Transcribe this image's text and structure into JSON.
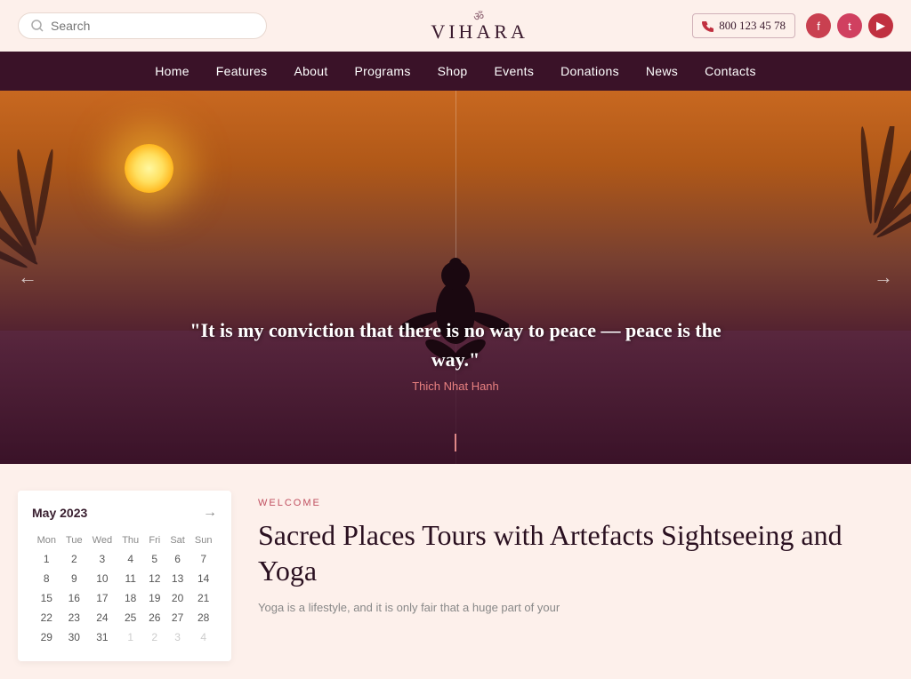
{
  "header": {
    "logo_name": "VIHARA",
    "logo_symbol": "ॐ",
    "search_placeholder": "Search",
    "phone": "800 123 45 78",
    "social": [
      {
        "name": "facebook",
        "label": "f"
      },
      {
        "name": "twitter",
        "label": "t"
      },
      {
        "name": "youtube",
        "label": "▶"
      }
    ]
  },
  "nav": {
    "items": [
      {
        "label": "Home",
        "id": "home"
      },
      {
        "label": "Features",
        "id": "features"
      },
      {
        "label": "About",
        "id": "about"
      },
      {
        "label": "Programs",
        "id": "programs"
      },
      {
        "label": "Shop",
        "id": "shop"
      },
      {
        "label": "Events",
        "id": "events"
      },
      {
        "label": "Donations",
        "id": "donations"
      },
      {
        "label": "News",
        "id": "news"
      },
      {
        "label": "Contacts",
        "id": "contacts"
      }
    ]
  },
  "hero": {
    "quote": "\"It is my conviction that there is no way to peace — peace is the way.\"",
    "author": "Thich Nhat Hanh",
    "arrow_left": "←",
    "arrow_right": "→"
  },
  "calendar": {
    "month_label": "May 2023",
    "nav_next": "→",
    "days_of_week": [
      "Mon",
      "Tue",
      "Wed",
      "Thu",
      "Fri",
      "Sat",
      "Sun"
    ],
    "weeks": [
      [
        {
          "day": "1",
          "other": false
        },
        {
          "day": "2",
          "other": false
        },
        {
          "day": "3",
          "other": false
        },
        {
          "day": "4",
          "other": false
        },
        {
          "day": "5",
          "other": false
        },
        {
          "day": "6",
          "other": false
        },
        {
          "day": "7",
          "other": false
        }
      ],
      [
        {
          "day": "8",
          "other": false
        },
        {
          "day": "9",
          "other": false
        },
        {
          "day": "10",
          "other": false
        },
        {
          "day": "11",
          "other": false
        },
        {
          "day": "12",
          "other": false
        },
        {
          "day": "13",
          "other": false
        },
        {
          "day": "14",
          "other": false
        }
      ],
      [
        {
          "day": "15",
          "other": false
        },
        {
          "day": "16",
          "other": false
        },
        {
          "day": "17",
          "other": false
        },
        {
          "day": "18",
          "other": false
        },
        {
          "day": "19",
          "other": false
        },
        {
          "day": "20",
          "other": false
        },
        {
          "day": "21",
          "other": false
        }
      ],
      [
        {
          "day": "22",
          "other": false
        },
        {
          "day": "23",
          "other": false
        },
        {
          "day": "24",
          "other": false
        },
        {
          "day": "25",
          "other": false
        },
        {
          "day": "26",
          "other": false
        },
        {
          "day": "27",
          "other": false
        },
        {
          "day": "28",
          "other": false
        }
      ],
      [
        {
          "day": "29",
          "other": false
        },
        {
          "day": "30",
          "other": false
        },
        {
          "day": "31",
          "other": false
        },
        {
          "day": "1",
          "other": true
        },
        {
          "day": "2",
          "other": true
        },
        {
          "day": "3",
          "other": true
        },
        {
          "day": "4",
          "other": true
        }
      ]
    ]
  },
  "welcome": {
    "label": "WELCOME",
    "title": "Sacred Places Tours with Artefacts Sightseeing and Yoga",
    "description": "Yoga is a lifestyle, and it is only fair that a huge part of your"
  }
}
